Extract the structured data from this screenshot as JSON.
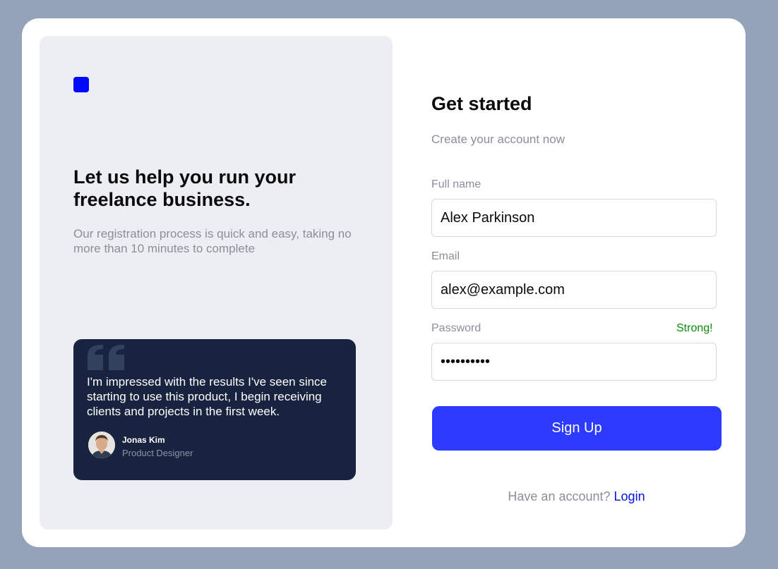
{
  "brand": {
    "logo_color": "#0008ff"
  },
  "promo": {
    "headline": "Let us help you run your freelance business.",
    "subtext": "Our registration process is quick and easy, taking no more than 10 minutes to complete"
  },
  "testimonial": {
    "quote": "I'm impressed with the results I've seen since starting to use this product, I begin receiving clients and projects in the first week.",
    "author_name": "Jonas Kim",
    "author_role": "Product Designer",
    "quote_icon": "quote-icon"
  },
  "form": {
    "title": "Get started",
    "subtitle": "Create your account now",
    "full_name": {
      "label": "Full name",
      "value": "Alex Parkinson"
    },
    "email": {
      "label": "Email",
      "value": "alex@example.com"
    },
    "password": {
      "label": "Password",
      "value": "••••••••••",
      "strength": "Strong!"
    },
    "submit_label": "Sign Up",
    "login_prompt": "Have an account?",
    "login_link": "Login"
  },
  "colors": {
    "background": "#94a3b8",
    "panel": "#edeef4",
    "testimonial_bg": "#18243f",
    "primary_button": "#2c3bff",
    "link": "#0012e8",
    "strength_ok": "#0c8a0c"
  }
}
